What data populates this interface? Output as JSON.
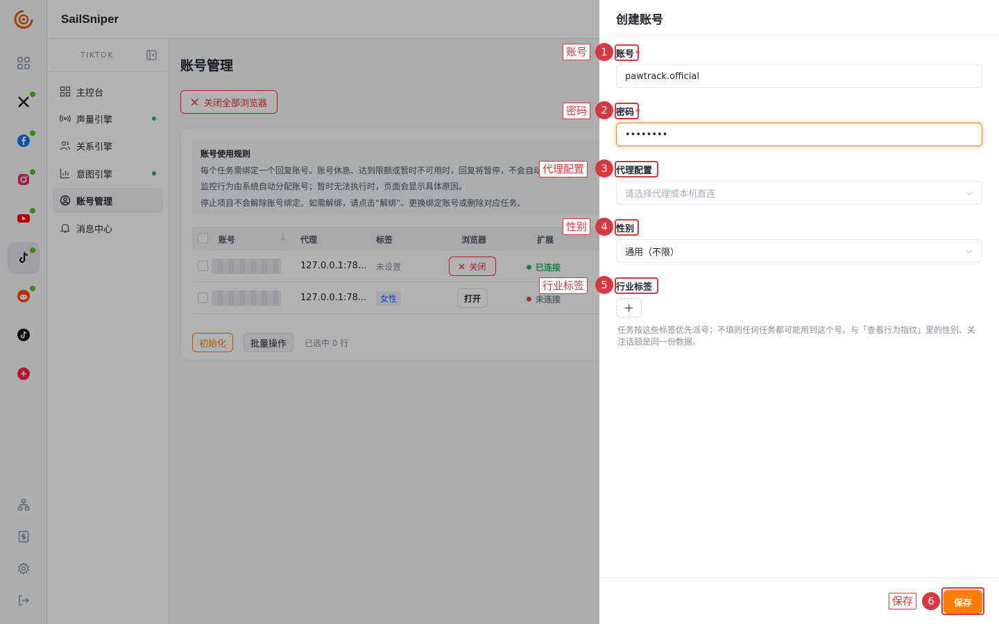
{
  "app": {
    "brand": "SailSniper"
  },
  "sidebar": {
    "platform": "TIKTOK",
    "items": [
      {
        "label": "主控台",
        "dot": false
      },
      {
        "label": "声量引擎",
        "dot": true
      },
      {
        "label": "关系引擎",
        "dot": false
      },
      {
        "label": "意图引擎",
        "dot": true
      },
      {
        "label": "账号管理",
        "dot": false
      },
      {
        "label": "消息中心",
        "dot": false
      }
    ]
  },
  "main": {
    "title": "账号管理",
    "close_all_label": "关闭全部浏览器",
    "rules": {
      "title": "账号使用规则",
      "line1": "每个任务需绑定一个回复账号。账号休息、达到限额或暂时不可用时，回复将暂停，不会自动",
      "line2": "监控行为由系统自动分配账号；暂时无法执行时，页面会显示具体原因。",
      "line3": "停止项目不会解除账号绑定。如需解绑，请点击“解绑”、更换绑定账号或删除对应任务。"
    },
    "table": {
      "headers": [
        "账号",
        "代理",
        "标签",
        "浏览器",
        "扩展"
      ],
      "rows": [
        {
          "proxy": "127.0.0.1:78...",
          "tag": "未设置",
          "browser": "关闭",
          "status": "已连接"
        },
        {
          "proxy": "127.0.0.1:78...",
          "tag": "女性",
          "browser": "打开",
          "status": "未连接"
        }
      ]
    },
    "footer": {
      "init_label": "初始化",
      "batch_label": "批量操作",
      "selected": "已选中 0 行"
    }
  },
  "drawer": {
    "title": "创建账号",
    "fields": {
      "account": {
        "label": "账号",
        "value": "pawtrack.official"
      },
      "password": {
        "label": "密码",
        "value": "••••••••"
      },
      "proxy": {
        "label": "代理配置",
        "placeholder": "请选择代理或本机直连"
      },
      "gender": {
        "label": "性别",
        "value": "通用（不限）"
      },
      "industry": {
        "label": "行业标签",
        "add": "+"
      }
    },
    "hint": "任务按这些标签优先派号；不填则任何任务都可能用到这个号。与「查看行为指纹」里的性别、关注话题是同一份数据。",
    "save_label": "保存"
  },
  "annotations": [
    {
      "num": "1",
      "label": "账号"
    },
    {
      "num": "2",
      "label": "密码"
    },
    {
      "num": "3",
      "label": "代理配置"
    },
    {
      "num": "4",
      "label": "性别"
    },
    {
      "num": "5",
      "label": "行业标签"
    },
    {
      "num": "6",
      "label": "保存"
    }
  ],
  "colors": {
    "accent": "#ff7d00",
    "danger": "#d9363e",
    "success": "#2db55d",
    "annotation": "#d9363e"
  }
}
